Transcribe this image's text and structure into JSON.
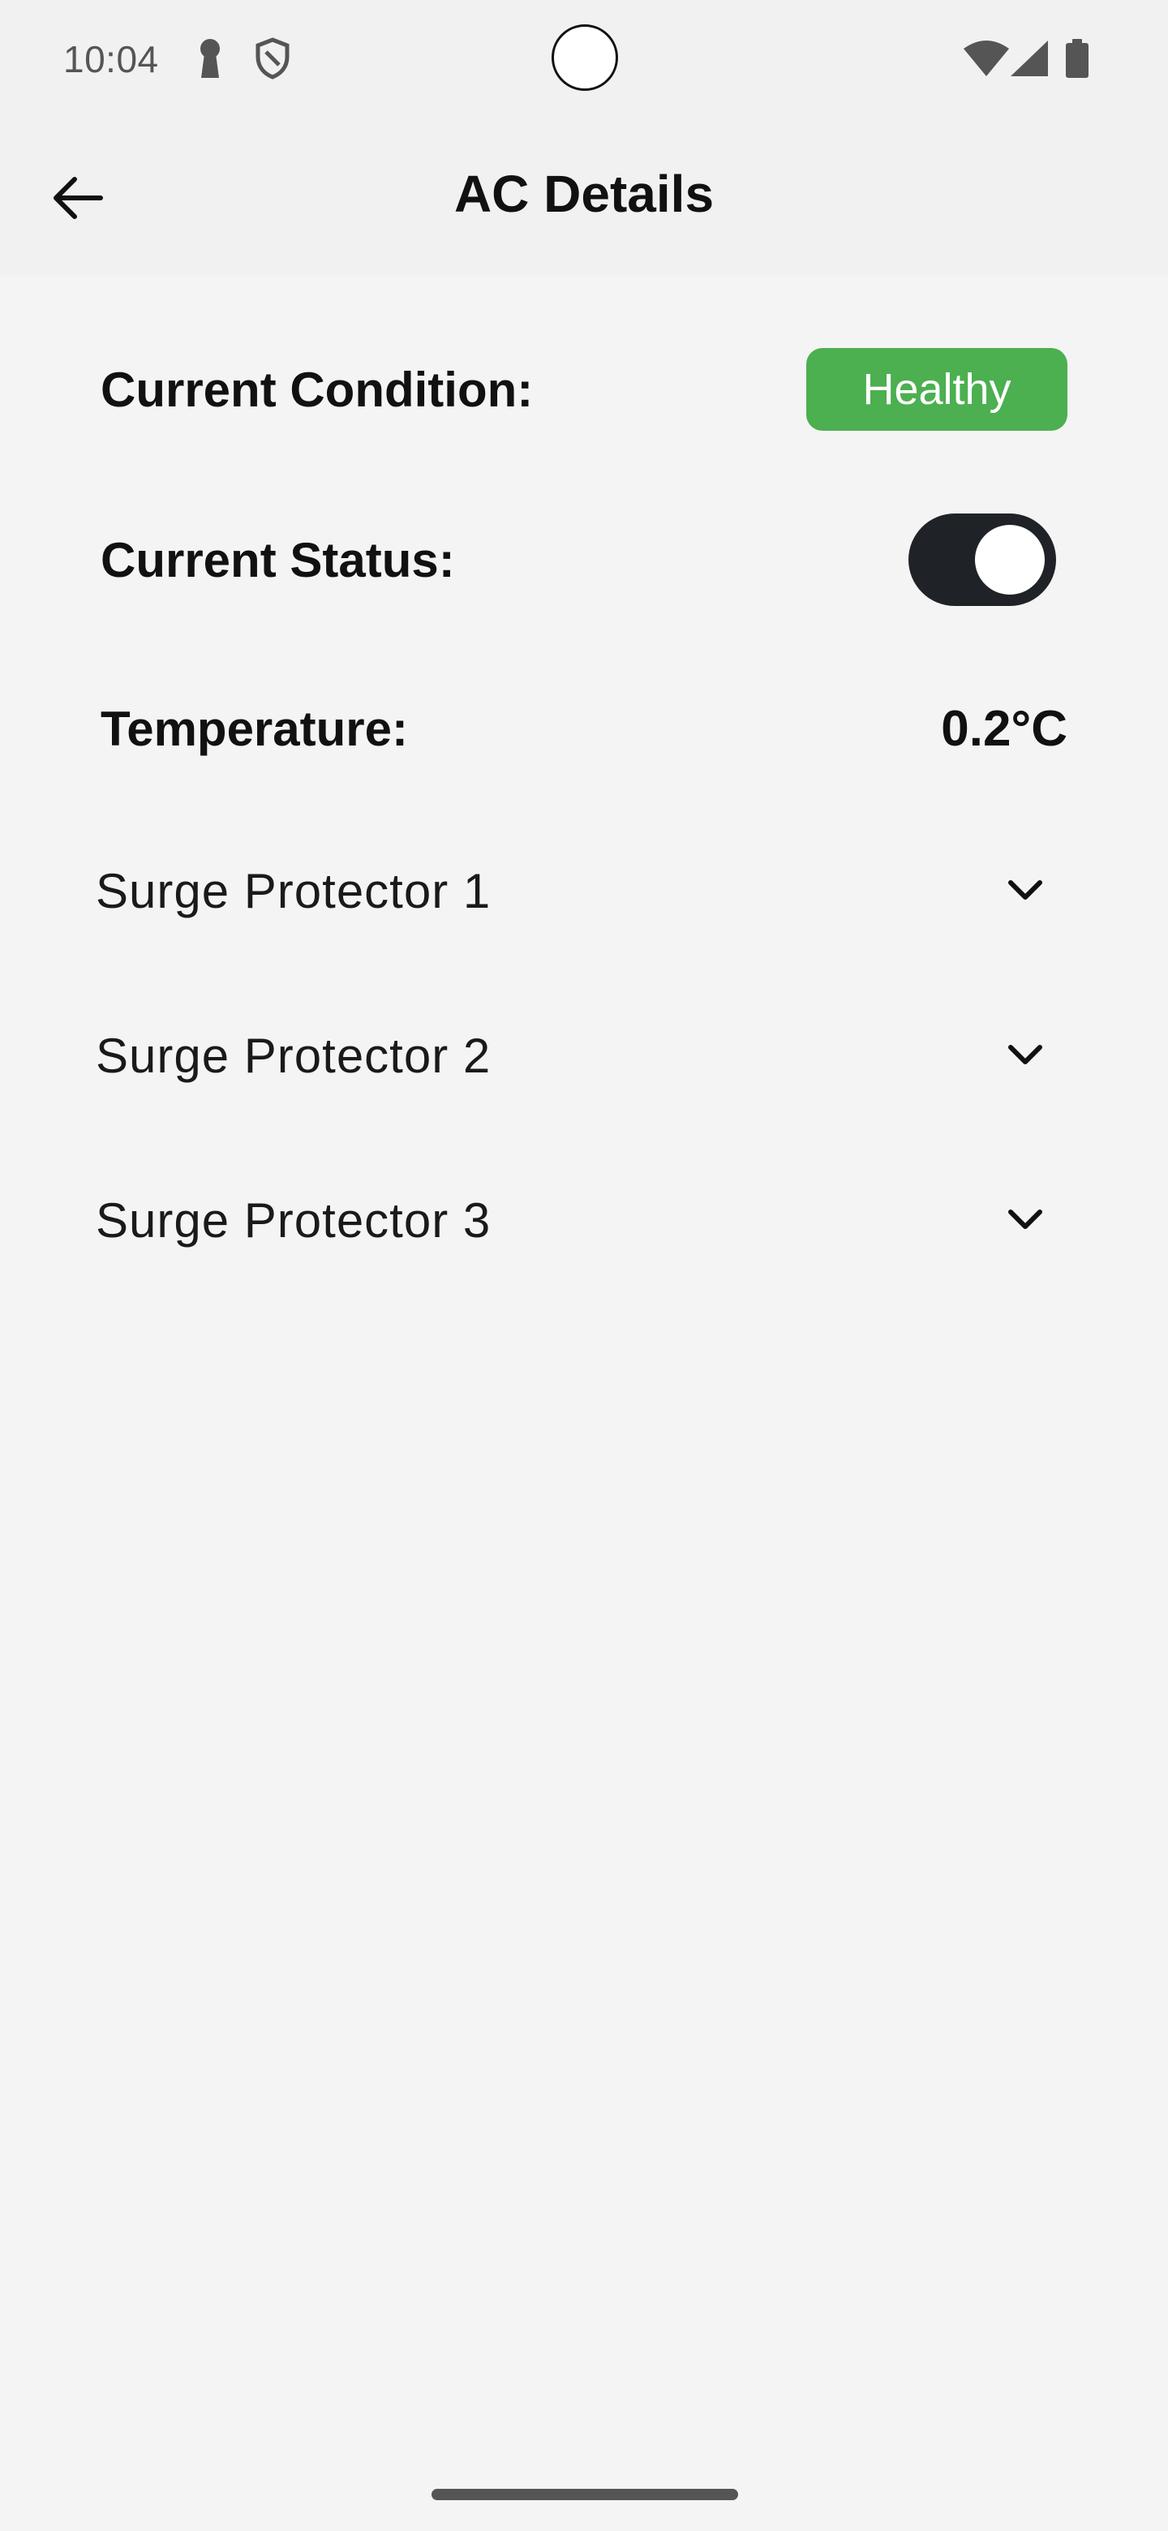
{
  "status_bar": {
    "time": "10:04",
    "icons": [
      "keyhole-icon",
      "shield-icon",
      "wifi-icon",
      "cell-signal-icon",
      "battery-icon"
    ]
  },
  "app_bar": {
    "title": "AC Details",
    "back_icon": "arrow-left-icon"
  },
  "details": {
    "condition_label": "Current Condition:",
    "condition_value": "Healthy",
    "condition_color": "#4caf50",
    "status_label": "Current Status:",
    "status_on": true,
    "temperature_label": "Temperature:",
    "temperature_value": "0.2°C"
  },
  "surge_protectors": [
    {
      "label": "Surge Protector 1",
      "icon": "chevron-down-icon"
    },
    {
      "label": "Surge Protector 2",
      "icon": "chevron-down-icon"
    },
    {
      "label": "Surge Protector 3",
      "icon": "chevron-down-icon"
    }
  ],
  "colors": {
    "background": "#f4f4f4",
    "header_background": "#f1f1f2",
    "toggle_track": "#1f2328",
    "text": "#111111"
  }
}
